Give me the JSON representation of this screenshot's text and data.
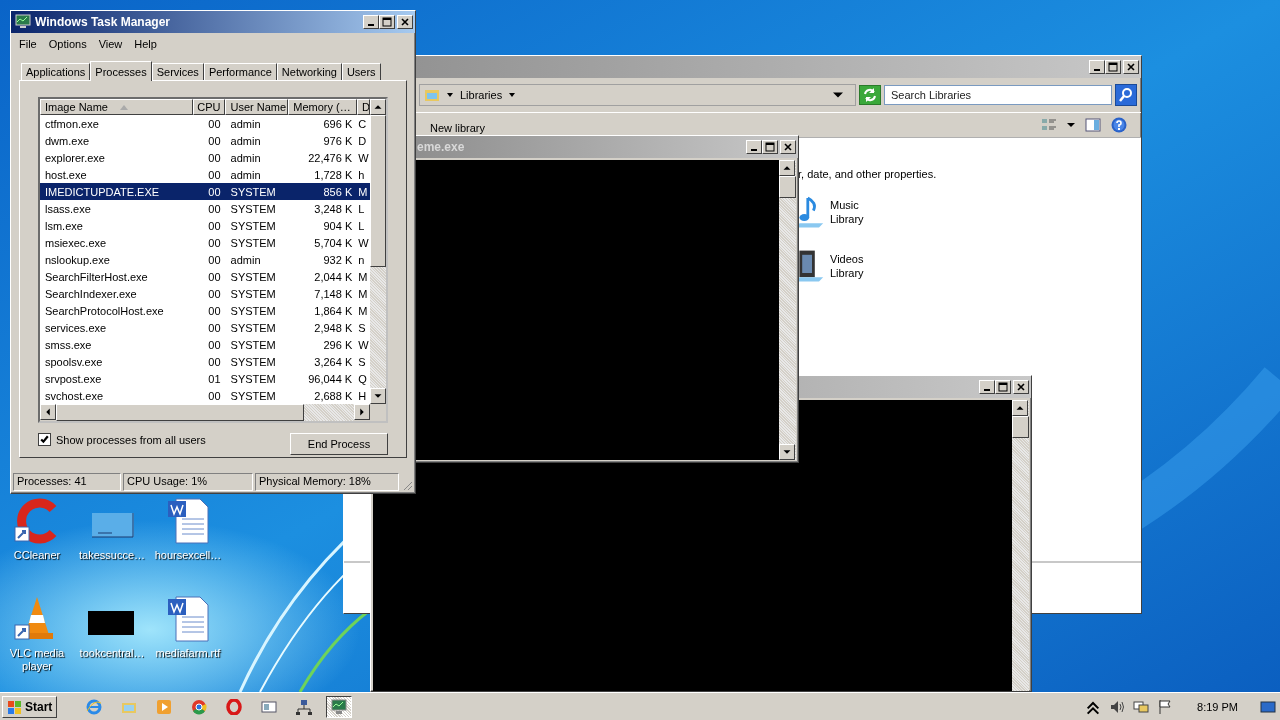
{
  "desktop_icons": [
    {
      "label": "CCleaner",
      "kind": "ccleaner"
    },
    {
      "label": "takessucce…",
      "kind": "blank"
    },
    {
      "label": "hoursexcell…",
      "kind": "word"
    },
    {
      "label": "VLC media player",
      "kind": "vlc"
    },
    {
      "label": "tookcentral…",
      "kind": "black"
    },
    {
      "label": "mediafarm.rtf",
      "kind": "word"
    }
  ],
  "explorer": {
    "active": false,
    "location": "Libraries",
    "search_placeholder": "Search Libraries",
    "toolbar_command": "New library",
    "description": "r, date, and other properties.",
    "libraries": [
      {
        "name": "Music",
        "sub": "Library",
        "kind": "music"
      },
      {
        "name": "Videos",
        "sub": "Library",
        "kind": "videos"
      }
    ]
  },
  "console_back": {
    "active": false
  },
  "console_front": {
    "active": false,
    "title": "eme.exe"
  },
  "task_manager": {
    "active": true,
    "title": "Windows Task Manager",
    "menu": [
      "File",
      "Options",
      "View",
      "Help"
    ],
    "tabs": [
      {
        "label": "Applications",
        "selected": false
      },
      {
        "label": "Processes",
        "selected": true
      },
      {
        "label": "Services",
        "selected": false
      },
      {
        "label": "Performance",
        "selected": false
      },
      {
        "label": "Networking",
        "selected": false
      },
      {
        "label": "Users",
        "selected": false
      }
    ],
    "columns": [
      "Image Name",
      "CPU",
      "User Name",
      "Memory (…",
      "D"
    ],
    "rows": [
      {
        "image": "ctfmon.exe",
        "cpu": "00",
        "user": "admin",
        "memory": "696 K",
        "d": "C",
        "selected": false
      },
      {
        "image": "dwm.exe",
        "cpu": "00",
        "user": "admin",
        "memory": "976 K",
        "d": "D",
        "selected": false
      },
      {
        "image": "explorer.exe",
        "cpu": "00",
        "user": "admin",
        "memory": "22,476 K",
        "d": "W",
        "selected": false
      },
      {
        "image": "host.exe",
        "cpu": "00",
        "user": "admin",
        "memory": "1,728 K",
        "d": "h",
        "selected": false
      },
      {
        "image": "IMEDICTUPDATE.EXE",
        "cpu": "00",
        "user": "SYSTEM",
        "memory": "856 K",
        "d": "M",
        "selected": true
      },
      {
        "image": "lsass.exe",
        "cpu": "00",
        "user": "SYSTEM",
        "memory": "3,248 K",
        "d": "L",
        "selected": false
      },
      {
        "image": "lsm.exe",
        "cpu": "00",
        "user": "SYSTEM",
        "memory": "904 K",
        "d": "L",
        "selected": false
      },
      {
        "image": "msiexec.exe",
        "cpu": "00",
        "user": "SYSTEM",
        "memory": "5,704 K",
        "d": "W",
        "selected": false
      },
      {
        "image": "nslookup.exe",
        "cpu": "00",
        "user": "admin",
        "memory": "932 K",
        "d": "n",
        "selected": false
      },
      {
        "image": "SearchFilterHost.exe",
        "cpu": "00",
        "user": "SYSTEM",
        "memory": "2,044 K",
        "d": "M",
        "selected": false
      },
      {
        "image": "SearchIndexer.exe",
        "cpu": "00",
        "user": "SYSTEM",
        "memory": "7,148 K",
        "d": "M",
        "selected": false
      },
      {
        "image": "SearchProtocolHost.exe",
        "cpu": "00",
        "user": "SYSTEM",
        "memory": "1,864 K",
        "d": "M",
        "selected": false
      },
      {
        "image": "services.exe",
        "cpu": "00",
        "user": "SYSTEM",
        "memory": "2,948 K",
        "d": "S",
        "selected": false
      },
      {
        "image": "smss.exe",
        "cpu": "00",
        "user": "SYSTEM",
        "memory": "296 K",
        "d": "W",
        "selected": false
      },
      {
        "image": "spoolsv.exe",
        "cpu": "00",
        "user": "SYSTEM",
        "memory": "3,264 K",
        "d": "S",
        "selected": false
      },
      {
        "image": "srvpost.exe",
        "cpu": "01",
        "user": "SYSTEM",
        "memory": "96,044 K",
        "d": "Q",
        "selected": false
      },
      {
        "image": "svchost.exe",
        "cpu": "00",
        "user": "SYSTEM",
        "memory": "2,688 K",
        "d": "H",
        "selected": false
      }
    ],
    "show_all_users": {
      "label": "Show processes from all users",
      "checked": true
    },
    "end_button": "End Process",
    "status_bar": [
      "Processes: 41",
      "CPU Usage: 1%",
      "Physical Memory: 18%"
    ]
  },
  "taskbar": {
    "start": "Start",
    "clock": "8:19 PM",
    "apps": [
      {
        "kind": "ie",
        "selected": false
      },
      {
        "kind": "folder",
        "selected": false
      },
      {
        "kind": "media",
        "selected": false
      },
      {
        "kind": "chrome",
        "selected": false
      },
      {
        "kind": "opera",
        "selected": false
      },
      {
        "kind": "window",
        "selected": false
      },
      {
        "kind": "network",
        "selected": false
      },
      {
        "kind": "monitor",
        "selected": true
      }
    ]
  }
}
